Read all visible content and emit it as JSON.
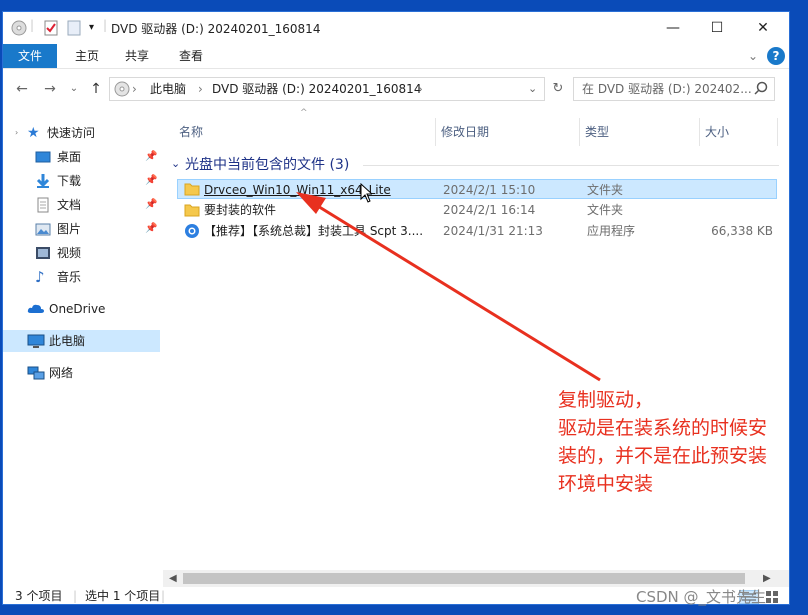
{
  "window": {
    "title": "DVD 驱动器 (D:) 20240201_160814",
    "controls": {
      "minimize": "—",
      "maximize": "☐",
      "close": "✕"
    }
  },
  "ribbon": {
    "tabs": [
      "文件",
      "主页",
      "共享",
      "查看"
    ],
    "expand": "⌄",
    "help": "?"
  },
  "address": {
    "back": "←",
    "forward": "→",
    "recent": "⌄",
    "up": "↑",
    "crumbs": [
      "此电脑",
      "DVD 驱动器 (D:) 20240201_160814"
    ],
    "separator": "›",
    "search_placeholder": "在 DVD 驱动器 (D:) 202402..."
  },
  "sidebar": {
    "quick_access": "快速访问",
    "items": [
      {
        "label": "桌面",
        "pinned": true
      },
      {
        "label": "下载",
        "pinned": true
      },
      {
        "label": "文档",
        "pinned": true
      },
      {
        "label": "图片",
        "pinned": true
      },
      {
        "label": "视频",
        "pinned": false
      },
      {
        "label": "音乐",
        "pinned": false
      }
    ],
    "onedrive": "OneDrive",
    "this_pc": "此电脑",
    "network": "网络"
  },
  "columns": {
    "name": "名称",
    "modified": "修改日期",
    "type": "类型",
    "size": "大小"
  },
  "group": {
    "label": "光盘中当前包含的文件 (3)"
  },
  "files": [
    {
      "name": "Drvceo_Win10_Win11_x64_Lite",
      "modified": "2024/2/1 15:10",
      "type": "文件夹",
      "size": "",
      "selected": true,
      "icon": "folder-icon"
    },
    {
      "name": "要封装的软件",
      "modified": "2024/2/1 16:14",
      "type": "文件夹",
      "size": "",
      "selected": false,
      "icon": "folder-icon"
    },
    {
      "name": "【推荐】【系统总裁】封装工具 Scpt 3....",
      "modified": "2024/1/31 21:13",
      "type": "应用程序",
      "size": "66,338 KB",
      "selected": false,
      "icon": "app-icon"
    }
  ],
  "status": {
    "count": "3 个项目",
    "selected": "选中 1 个项目"
  },
  "annotation": {
    "lines": [
      "复制驱动，",
      "驱动是在装系统的时候安",
      "装的，并不是在此预安装",
      "环境中安装"
    ],
    "color": "#e8301f"
  },
  "watermark": "CSDN @_文书先生"
}
